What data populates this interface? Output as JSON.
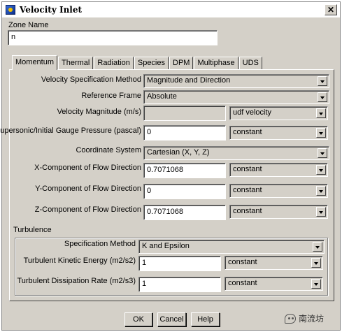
{
  "window": {
    "title": "Velocity Inlet",
    "close_glyph": "✕"
  },
  "zone": {
    "label": "Zone Name",
    "value": "n"
  },
  "tabs": [
    "Momentum",
    "Thermal",
    "Radiation",
    "Species",
    "DPM",
    "Multiphase",
    "UDS"
  ],
  "momentum": {
    "velocity_spec_method": {
      "label": "Velocity Specification Method",
      "value": "Magnitude and Direction"
    },
    "reference_frame": {
      "label": "Reference Frame",
      "value": "Absolute"
    },
    "velocity_magnitude": {
      "label": "Velocity Magnitude (m/s)",
      "value": "",
      "method": "udf velocity"
    },
    "gauge_pressure": {
      "label": "Supersonic/Initial Gauge Pressure (pascal)",
      "value": "0",
      "method": "constant"
    },
    "coordinate_system": {
      "label": "Coordinate System",
      "value": "Cartesian (X, Y, Z)"
    },
    "x_component": {
      "label": "X-Component of Flow Direction",
      "value": "0.7071068",
      "method": "constant"
    },
    "y_component": {
      "label": "Y-Component of Flow Direction",
      "value": "0",
      "method": "constant"
    },
    "z_component": {
      "label": "Z-Component of Flow Direction",
      "value": "0.7071068",
      "method": "constant"
    }
  },
  "turbulence": {
    "group_label": "Turbulence",
    "spec_method": {
      "label": "Specification Method",
      "value": "K and Epsilon"
    },
    "kinetic_energy": {
      "label": "Turbulent Kinetic Energy (m2/s2)",
      "value": "1",
      "method": "constant"
    },
    "dissipation_rate": {
      "label": "Turbulent Dissipation Rate (m2/s3)",
      "value": "1",
      "method": "constant"
    }
  },
  "buttons": {
    "ok": "OK",
    "cancel": "Cancel",
    "help": "Help"
  },
  "watermark": {
    "text": "南流坊",
    "icon": "wechat-icon"
  }
}
